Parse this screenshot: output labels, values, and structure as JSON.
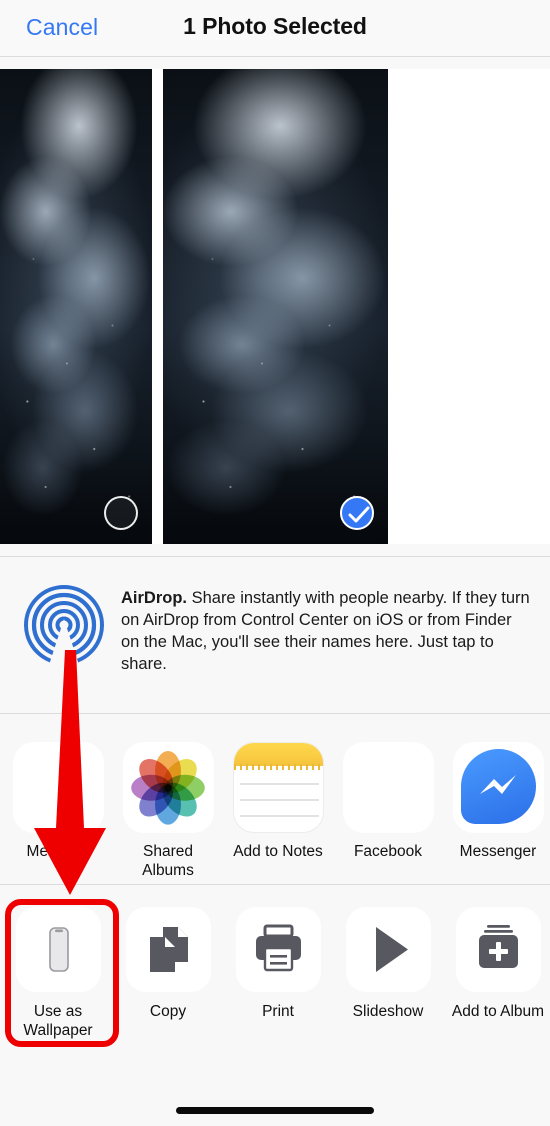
{
  "header": {
    "cancel_label": "Cancel",
    "title": "1 Photo Selected",
    "accent_color": "#3478f6"
  },
  "photos": {
    "items": [
      {
        "name": "photo-thumb-1",
        "selected": false,
        "selection_icon": "empty-circle-icon"
      },
      {
        "name": "photo-thumb-2",
        "selected": true,
        "selection_icon": "checkmark-circle-icon"
      }
    ]
  },
  "airdrop": {
    "icon": "airdrop-icon",
    "title": "AirDrop.",
    "description": " Share instantly with people nearby. If they turn on AirDrop from Control Center on iOS or from Finder on the Mac, you'll see their names here. Just tap to share.",
    "icon_color": "#2f6fd0"
  },
  "apps": {
    "items": [
      {
        "label": "Message",
        "icon": "messages-app-icon"
      },
      {
        "label": "Shared\nAlbums",
        "label_line1": "Shared",
        "label_line2": "Albums",
        "icon": "photos-app-icon"
      },
      {
        "label": "Add to Notes",
        "icon": "notes-app-icon"
      },
      {
        "label": "Facebook",
        "icon": "facebook-app-icon"
      },
      {
        "label": "Messenger",
        "icon": "messenger-app-icon"
      }
    ]
  },
  "actions": {
    "items": [
      {
        "label": "Use as\nWallpaper",
        "label_line1": "Use as",
        "label_line2": "Wallpaper",
        "icon": "iphone-wallpaper-icon",
        "highlighted": true
      },
      {
        "label": "Copy",
        "icon": "copy-icon"
      },
      {
        "label": "Print",
        "icon": "printer-icon"
      },
      {
        "label": "Slideshow",
        "icon": "play-triangle-icon"
      },
      {
        "label": "Add to Album",
        "icon": "add-to-album-icon"
      }
    ]
  },
  "annotation": {
    "arrow_color": "#ef0000",
    "highlight_color": "#ef0000",
    "points_to": "Use as Wallpaper"
  },
  "home_indicator": {
    "name": "home-indicator"
  }
}
